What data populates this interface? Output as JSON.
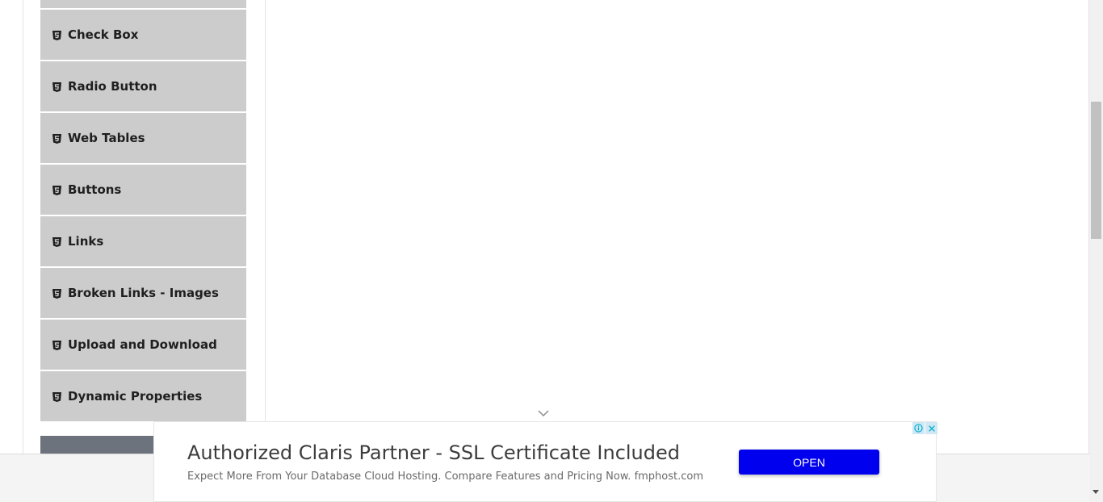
{
  "sidebar": {
    "items": [
      {
        "label": "",
        "icon": "html5-icon"
      },
      {
        "label": "Check Box",
        "icon": "html5-icon"
      },
      {
        "label": "Radio Button",
        "icon": "html5-icon"
      },
      {
        "label": "Web Tables",
        "icon": "html5-icon"
      },
      {
        "label": "Buttons",
        "icon": "html5-icon"
      },
      {
        "label": "Links",
        "icon": "html5-icon"
      },
      {
        "label": "Broken Links - Images",
        "icon": "html5-icon"
      },
      {
        "label": "Upload and Download",
        "icon": "html5-icon"
      },
      {
        "label": "Dynamic Properties",
        "icon": "html5-icon"
      }
    ]
  },
  "ad": {
    "headline": "Authorized Claris Partner - SSL Certificate Included",
    "description": "Expect More From Your Database Cloud Hosting. Compare Features and Pricing Now. fmphost.com",
    "cta_label": "OPEN",
    "cta_color": "#0000ee"
  },
  "colors": {
    "menu_item_bg": "#cccccc",
    "collapsed_group_bg": "#6c737c",
    "ad_badge_bg": "#cfe8f4"
  }
}
